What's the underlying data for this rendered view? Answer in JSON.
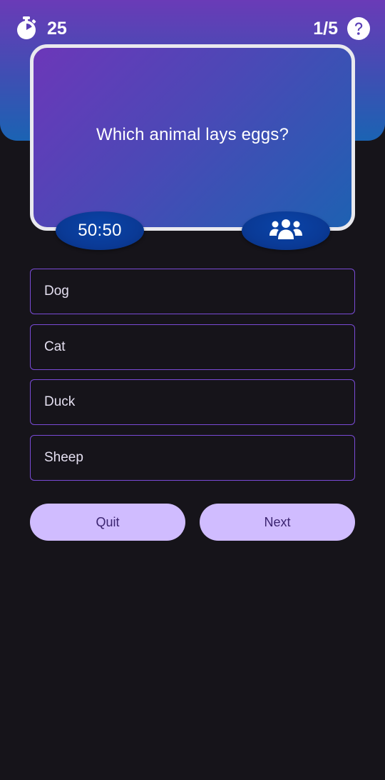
{
  "header": {
    "timer_icon": "stopwatch-icon",
    "timer_value": "25",
    "progress": "1/5",
    "help_icon": "help-circle-icon"
  },
  "question": {
    "text": "Which animal lays eggs?"
  },
  "lifelines": {
    "fifty_fifty_label": "50:50",
    "audience_icon": "people-group-icon"
  },
  "answers": [
    {
      "label": "Dog"
    },
    {
      "label": "Cat"
    },
    {
      "label": "Duck"
    },
    {
      "label": "Sheep"
    }
  ],
  "buttons": {
    "quit": "Quit",
    "next": "Next"
  },
  "colors": {
    "background": "#16141a",
    "header_gradient_top": "#6a3bb7",
    "header_gradient_bottom": "#1b63b3",
    "answer_border": "#7a4bd6",
    "button_bg": "#d0bcff",
    "button_text": "#3b2470",
    "lifeline_bg": "#0a3a96"
  }
}
